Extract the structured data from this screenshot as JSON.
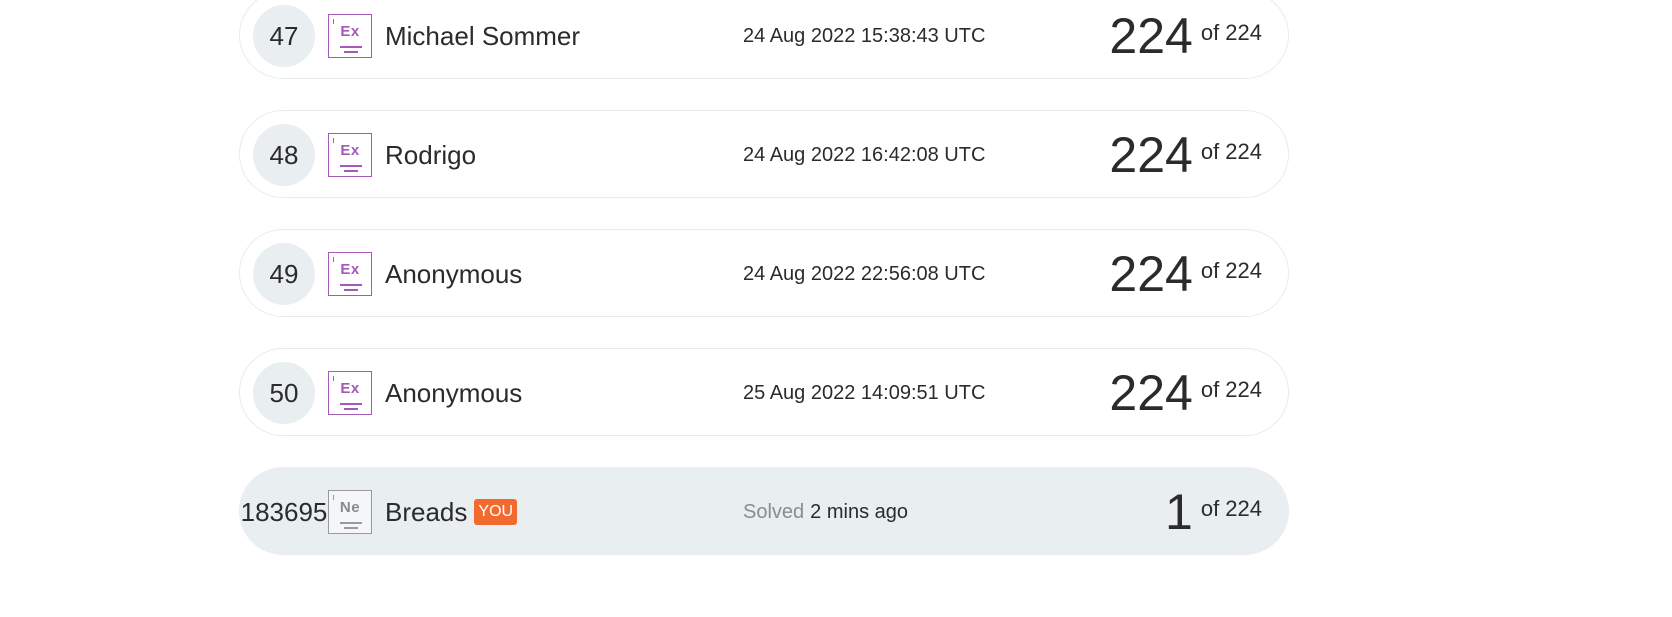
{
  "leaderboard": {
    "rows": [
      {
        "rank": "47",
        "level_symbol": "Ex",
        "name": "Michael Sommer",
        "time": "24 Aug 2022 15:38:43 UTC",
        "score": "224",
        "of_total": "of 224"
      },
      {
        "rank": "48",
        "level_symbol": "Ex",
        "name": "Rodrigo",
        "time": "24 Aug 2022 16:42:08 UTC",
        "score": "224",
        "of_total": "of 224"
      },
      {
        "rank": "49",
        "level_symbol": "Ex",
        "name": "Anonymous",
        "time": "24 Aug 2022 22:56:08 UTC",
        "score": "224",
        "of_total": "of 224"
      },
      {
        "rank": "50",
        "level_symbol": "Ex",
        "name": "Anonymous",
        "time": "25 Aug 2022 14:09:51 UTC",
        "score": "224",
        "of_total": "of 224"
      }
    ],
    "you_row": {
      "rank": "183695",
      "level_symbol": "Ne",
      "name": "Breads",
      "badge": "YOU",
      "solved_label": "Solved",
      "time": "2 mins ago",
      "score": "1",
      "of_total": "of 224"
    }
  },
  "colors": {
    "expert_level": "#a55ab8",
    "you_badge": "#f26a2e",
    "row_highlight": "#e9eef0"
  }
}
